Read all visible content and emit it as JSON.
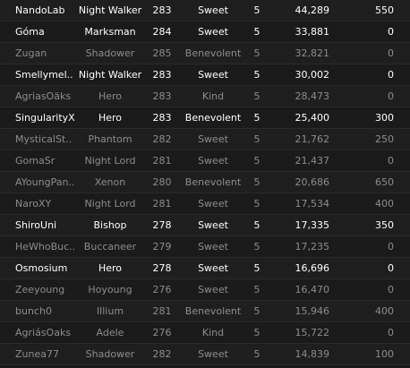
{
  "colors": {
    "bright_text": "#ffffff",
    "dim_text": "#8d8d8d",
    "background": "#1a1a1a"
  },
  "rows": [
    {
      "name": "NandoLab",
      "job": "Night Walker",
      "level": "283",
      "fame": "Sweet",
      "world": "5",
      "score": "44,289",
      "points": "550",
      "style": "bright"
    },
    {
      "name": "Góma",
      "job": "Marksman",
      "level": "284",
      "fame": "Sweet",
      "world": "5",
      "score": "33,881",
      "points": "0",
      "style": "bright"
    },
    {
      "name": "Zugan",
      "job": "Shadower",
      "level": "285",
      "fame": "Benevolent",
      "world": "5",
      "score": "32,821",
      "points": "0",
      "style": "dim"
    },
    {
      "name": "Smellymel..",
      "job": "Night Walker",
      "level": "283",
      "fame": "Sweet",
      "world": "5",
      "score": "30,002",
      "points": "0",
      "style": "bright"
    },
    {
      "name": "AgriasOäks",
      "job": "Hero",
      "level": "283",
      "fame": "Kind",
      "world": "5",
      "score": "28,473",
      "points": "0",
      "style": "dim"
    },
    {
      "name": "SingularityX",
      "job": "Hero",
      "level": "283",
      "fame": "Benevolent",
      "world": "5",
      "score": "25,400",
      "points": "300",
      "style": "bright"
    },
    {
      "name": "MysticalSt..",
      "job": "Phantom",
      "level": "282",
      "fame": "Sweet",
      "world": "5",
      "score": "21,762",
      "points": "250",
      "style": "dim"
    },
    {
      "name": "GomaSr",
      "job": "Night Lord",
      "level": "281",
      "fame": "Sweet",
      "world": "5",
      "score": "21,437",
      "points": "0",
      "style": "dim"
    },
    {
      "name": "AYoungPan..",
      "job": "Xenon",
      "level": "280",
      "fame": "Benevolent",
      "world": "5",
      "score": "20,686",
      "points": "650",
      "style": "dim"
    },
    {
      "name": "NaroXY",
      "job": "Night Lord",
      "level": "281",
      "fame": "Sweet",
      "world": "5",
      "score": "17,534",
      "points": "400",
      "style": "dim"
    },
    {
      "name": "ShiroUni",
      "job": "Bishop",
      "level": "278",
      "fame": "Sweet",
      "world": "5",
      "score": "17,335",
      "points": "350",
      "style": "bright"
    },
    {
      "name": "HeWhoBuc..",
      "job": "Buccaneer",
      "level": "279",
      "fame": "Sweet",
      "world": "5",
      "score": "17,235",
      "points": "0",
      "style": "dim"
    },
    {
      "name": "Osmosium",
      "job": "Hero",
      "level": "278",
      "fame": "Sweet",
      "world": "5",
      "score": "16,696",
      "points": "0",
      "style": "bright"
    },
    {
      "name": "Zeeyoung",
      "job": "Hoyoung",
      "level": "276",
      "fame": "Sweet",
      "world": "5",
      "score": "16,470",
      "points": "0",
      "style": "dim"
    },
    {
      "name": "bunch0",
      "job": "Illium",
      "level": "281",
      "fame": "Benevolent",
      "world": "5",
      "score": "15,946",
      "points": "400",
      "style": "dim"
    },
    {
      "name": "AgriásOaks",
      "job": "Adele",
      "level": "276",
      "fame": "Kind",
      "world": "5",
      "score": "15,722",
      "points": "0",
      "style": "dim"
    },
    {
      "name": "Zunea77",
      "job": "Shadower",
      "level": "282",
      "fame": "Sweet",
      "world": "5",
      "score": "14,839",
      "points": "100",
      "style": "dim"
    }
  ]
}
